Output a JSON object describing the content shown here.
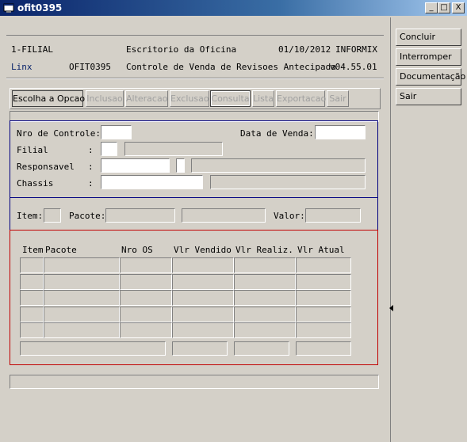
{
  "window": {
    "title": "ofit0395",
    "minimize": "_",
    "maximize": "□",
    "close": "X"
  },
  "header": {
    "filial": "1-FILIAL",
    "app_title": "Escritorio da Oficina",
    "date": "01/10/2012",
    "db": "INFORMIX",
    "brand": "Linx",
    "program": "OFIT0395",
    "subtitle": "Controle de Venda de Revisoes Antecipada",
    "version": "v04.55.01"
  },
  "side_buttons": [
    "Concluir",
    "Interromper",
    "Documentação",
    "Sair"
  ],
  "toolbar": [
    "Escolha a Opcao",
    "Inclusao",
    "Alteracao",
    "Exclusao",
    "Consulta",
    "Lista",
    "Exportacao",
    "Sair"
  ],
  "form": {
    "nro_controle_label": "Nro de Controle:",
    "data_venda_label": "Data de Venda:",
    "filial_label": "Filial",
    "responsavel_label": "Responsavel",
    "chassis_label": "Chassis",
    "colon": ":"
  },
  "item_row": {
    "item_label": "Item:",
    "pacote_label": "Pacote:",
    "valor_label": "Valor:"
  },
  "grid": {
    "columns": [
      "Item",
      "Pacote",
      "Nro OS",
      "Vlr Vendido",
      "Vlr Realiz.",
      "Vlr Atual"
    ],
    "row_count": 5
  }
}
